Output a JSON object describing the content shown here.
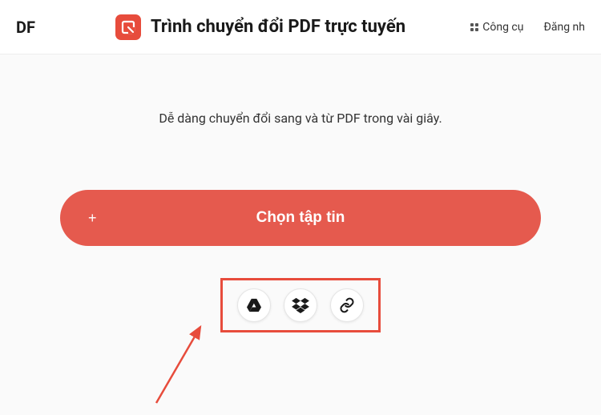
{
  "header": {
    "left_fragment": "DF",
    "title": "Trình chuyển đổi PDF trực tuyến",
    "tools_label": "Công cụ",
    "login_label": "Đăng nh"
  },
  "main": {
    "subtitle": "Dễ dàng chuyển đổi sang và từ PDF trong vài giây.",
    "choose_file_label": "Chọn tập tin"
  },
  "sources": {
    "gdrive": "google-drive",
    "dropbox": "dropbox",
    "link": "link"
  }
}
